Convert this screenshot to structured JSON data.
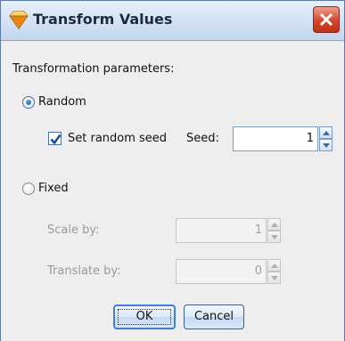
{
  "window": {
    "title": "Transform Values",
    "colors": {
      "title_bg": "#d6e4f5",
      "close_button": "#d2472b",
      "body_bg": "#eeeeee"
    }
  },
  "dialog": {
    "section_label": "Transformation parameters:",
    "random": {
      "label": "Random",
      "selected": true
    },
    "seed_checkbox": {
      "label": "Set random seed",
      "checked": true
    },
    "seed": {
      "label": "Seed:",
      "value": "1"
    },
    "fixed": {
      "label": "Fixed",
      "selected": false
    },
    "scale_by": {
      "label": "Scale by:",
      "value": "1",
      "enabled": false
    },
    "translate_by": {
      "label": "Translate by:",
      "value": "0",
      "enabled": false
    }
  },
  "buttons": {
    "ok": "OK",
    "cancel": "Cancel"
  },
  "icons": {
    "app": "diamond-icon",
    "close": "close-icon",
    "check": "checkmark-icon"
  }
}
